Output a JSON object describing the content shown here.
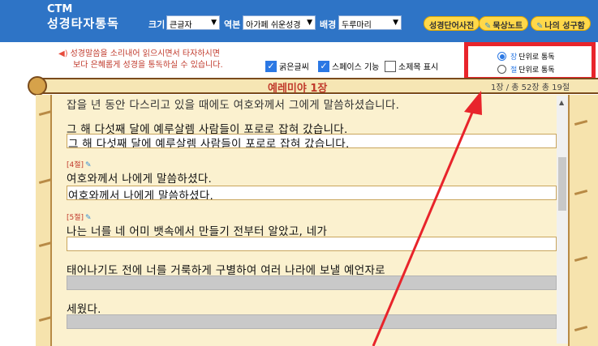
{
  "header": {
    "brand_en": "CTM",
    "brand_ko": "성경타자통독",
    "size_label": "크기",
    "size_value": "큰글자",
    "version_label": "역본",
    "version_value": "아가페 쉬운성경",
    "bg_label": "배경",
    "bg_value": "두루마리",
    "btn_dictionary": "성경단어사전",
    "btn_notes": "묵상노트",
    "btn_mybible": "나의 성구함"
  },
  "info": {
    "line1": "성경말씀을 소리내어 읽으시면서 타자하시면",
    "line2": "보다 은혜롭게 성경을 통독하실 수 있습니다.",
    "opt_bold": "굵은글씨",
    "opt_space": "스페이스 기능",
    "opt_subtitle": "소제목 표시"
  },
  "mode": {
    "chapter_key": "장",
    "chapter_rest": "단위로 통독",
    "verse_key": "절",
    "verse_rest": "단위로 통독"
  },
  "chapter": {
    "title": "예레미야 1장",
    "info": "1장 / 총 52장   총 19절"
  },
  "text": {
    "partial_top": "잡을 년 동안 다스리고 있을 때에도 여호와께서 그에게 말씀하셨습니다.",
    "v3_line": "그 해 다섯째 달에 예루살렘 사람들이 포로로 잡혀 갔습니다.",
    "v3_typed": "그 해 다섯째 달에 예루살렘 사람들이 포로로 잡혀 갔습니다.",
    "v4_label": "[4절]",
    "v4_line": "여호와께서 나에게 말씀하셨다.",
    "v4_typed": "여호와께서 나에게 말씀하셨다.",
    "v5_label": "[5절]",
    "v5_line1": "나는 너를 네 어미 뱃속에서 만들기 전부터 알았고, 네가",
    "v5_line2": "태어나기도 전에 너를 거룩하게 구별하여 여러 나라에 보낼 예언자로",
    "v5_line3": "세웠다."
  }
}
